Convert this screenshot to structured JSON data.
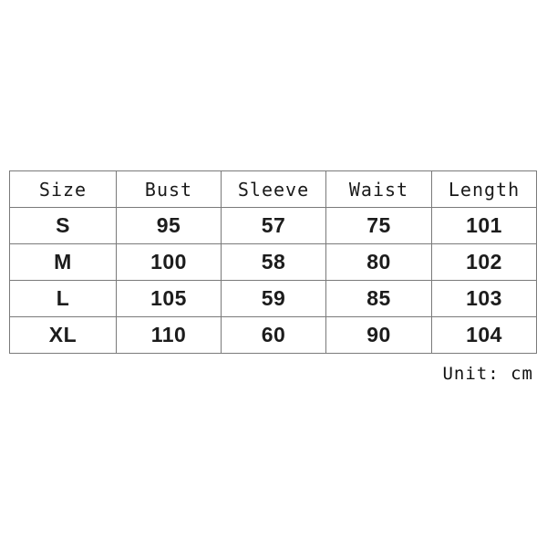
{
  "table": {
    "headers": [
      "Size",
      "Bust",
      "Sleeve",
      "Waist",
      "Length"
    ],
    "rows": [
      {
        "size": "S",
        "bust": "95",
        "sleeve": "57",
        "waist": "75",
        "length": "101"
      },
      {
        "size": "M",
        "bust": "100",
        "sleeve": "58",
        "waist": "80",
        "length": "102"
      },
      {
        "size": "L",
        "bust": "105",
        "sleeve": "59",
        "waist": "85",
        "length": "103"
      },
      {
        "size": "XL",
        "bust": "110",
        "sleeve": "60",
        "waist": "90",
        "length": "104"
      }
    ]
  },
  "unit_note": "Unit: cm",
  "colors": {
    "background": "#ffffff",
    "border": "#7a7a7a",
    "header_text": "#1a1a1a",
    "data_text": "#1c1c1c"
  }
}
